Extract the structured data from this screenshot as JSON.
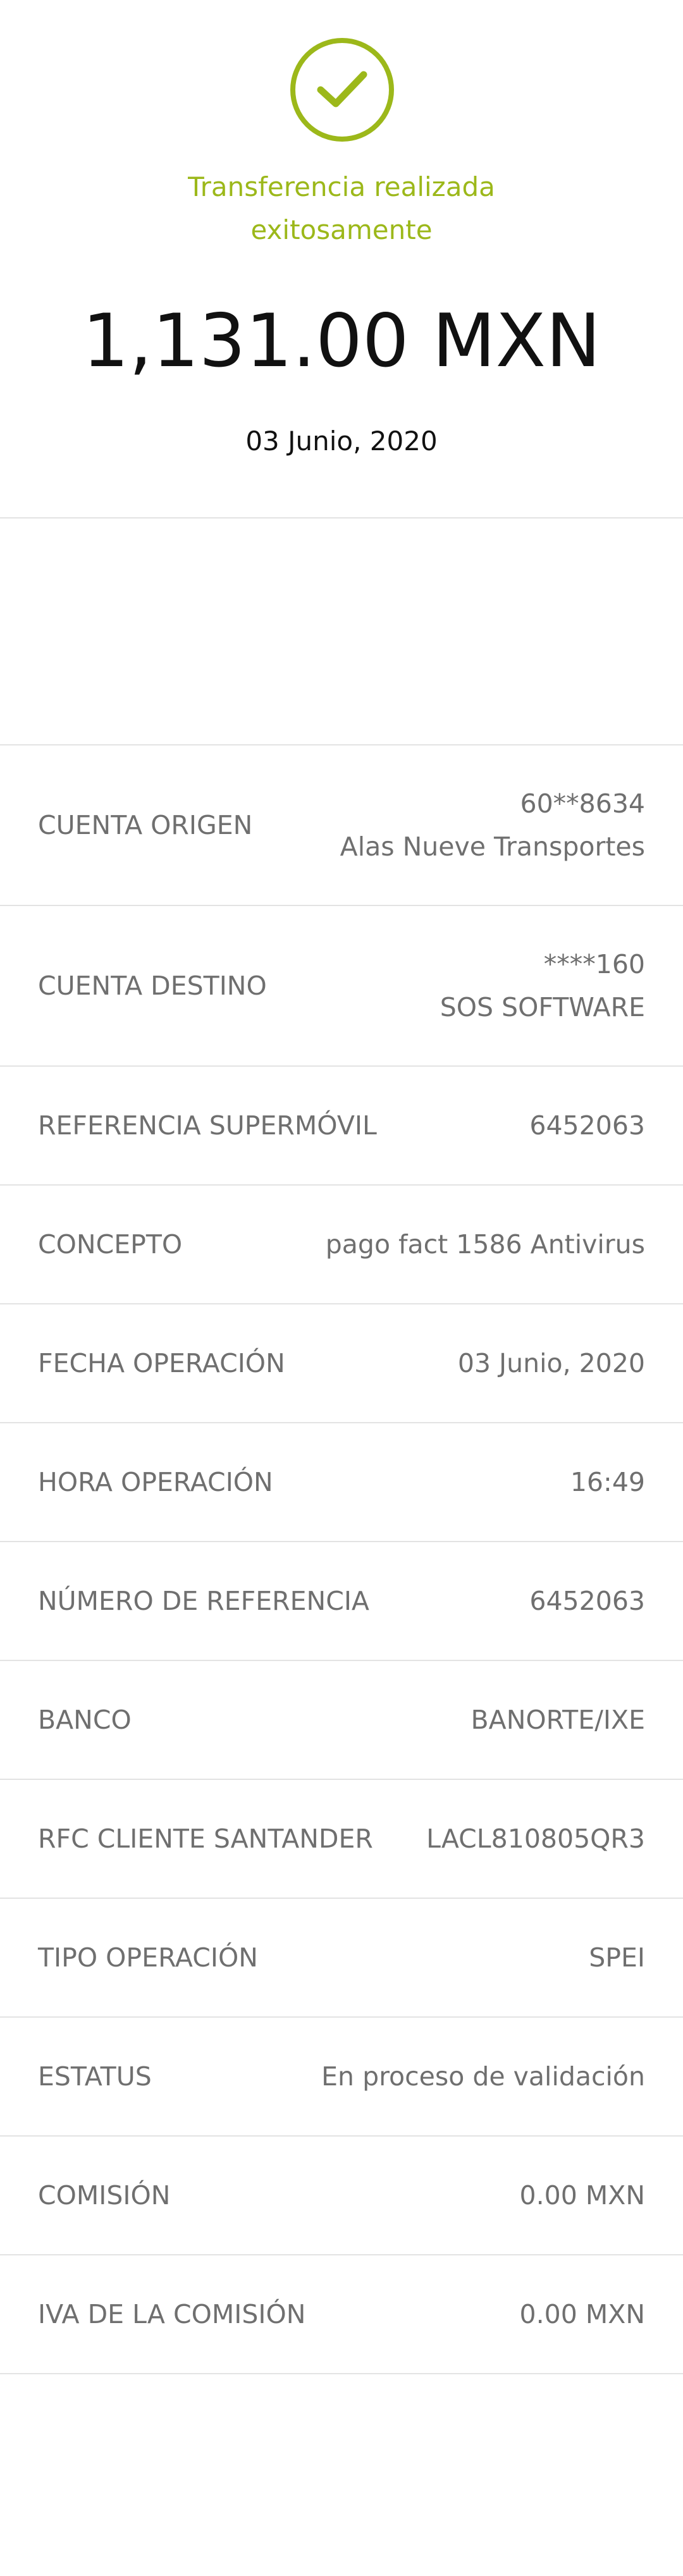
{
  "header": {
    "status_line1": "Transferencia realizada",
    "status_line2": "exitosamente",
    "amount": "1,131.00 MXN",
    "date": "03 Junio, 2020"
  },
  "colors": {
    "accent": "#9cb81a",
    "text_dark": "#111111",
    "text_gray": "#6f6f6f",
    "divider": "#e3e3e3"
  },
  "details": {
    "cuenta_origen": {
      "label": "CUENTA ORIGEN",
      "value1": "60**8634",
      "value2": "Alas Nueve Transportes"
    },
    "cuenta_destino": {
      "label": "CUENTA DESTINO",
      "value1": "****160",
      "value2": "SOS SOFTWARE"
    },
    "referencia_supermovil": {
      "label": "REFERENCIA SUPERMÓVIL",
      "value": "6452063"
    },
    "concepto": {
      "label": "CONCEPTO",
      "value": "pago fact 1586 Antivirus"
    },
    "fecha_operacion": {
      "label": "FECHA OPERACIÓN",
      "value": "03 Junio, 2020"
    },
    "hora_operacion": {
      "label": "HORA OPERACIÓN",
      "value": "16:49"
    },
    "numero_referencia": {
      "label": "NÚMERO DE REFERENCIA",
      "value": "6452063"
    },
    "banco": {
      "label": "BANCO",
      "value": "BANORTE/IXE"
    },
    "rfc_cliente": {
      "label": "RFC CLIENTE SANTANDER",
      "value": "LACL810805QR3"
    },
    "tipo_operacion": {
      "label": "TIPO OPERACIÓN",
      "value": "SPEI"
    },
    "estatus": {
      "label": "ESTATUS",
      "value": "En proceso de validación"
    },
    "comision": {
      "label": "COMISIÓN",
      "value": "0.00 MXN"
    },
    "iva_comision": {
      "label": "IVA DE LA COMISIÓN",
      "value": "0.00 MXN"
    }
  }
}
